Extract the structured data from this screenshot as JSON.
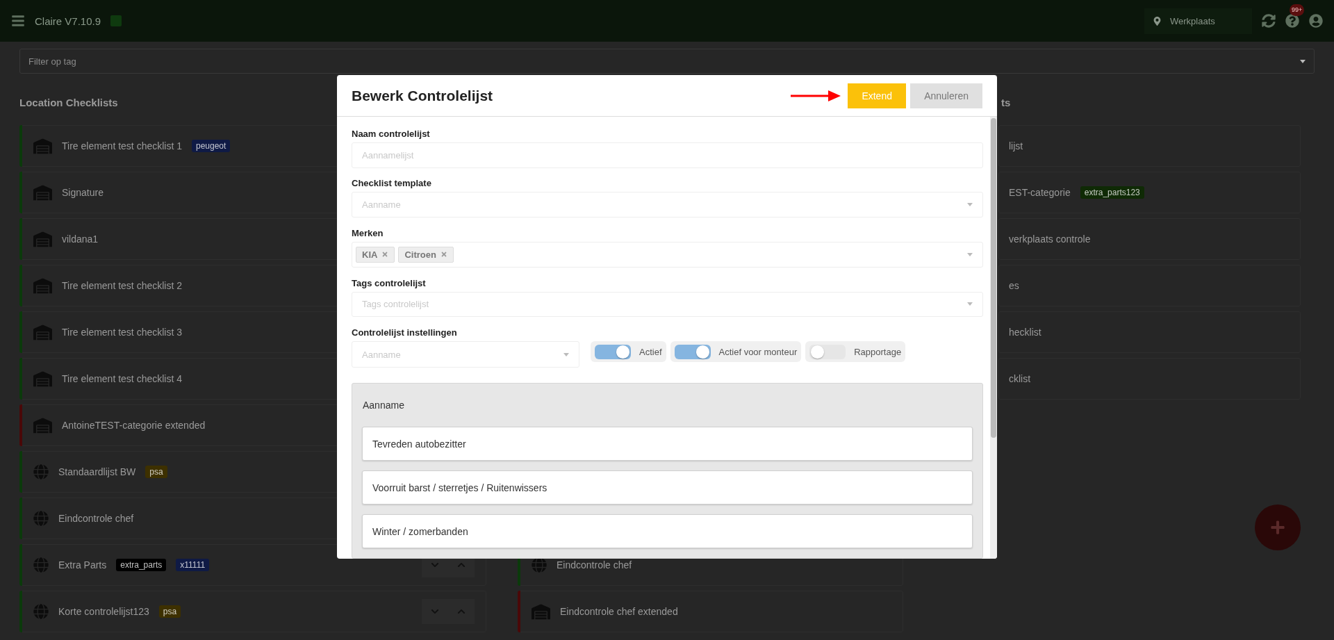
{
  "app": {
    "title": "Claire V7.10.9",
    "location": {
      "placeholder": "Werkplaats"
    },
    "notification_count": "99+"
  },
  "filter": {
    "placeholder": "Filter op tag"
  },
  "columns": [
    {
      "heading": "Location Checklists",
      "items": [
        {
          "name": "Tire element test checklist 1",
          "kind": "location",
          "color": "#0b3a0b",
          "tags": [
            {
              "label": "peugeot",
              "color": "#0f1a45"
            }
          ]
        },
        {
          "name": "Signature",
          "kind": "location",
          "color": "#0b3a0b"
        },
        {
          "name": "vildana1",
          "kind": "location",
          "color": "#0b3a0b"
        },
        {
          "name": "Tire element test checklist 2",
          "kind": "location",
          "color": "#0b3a0b"
        },
        {
          "name": "Tire element test checklist 3",
          "kind": "location",
          "color": "#0b3a0b"
        },
        {
          "name": "Tire element test checklist 4",
          "kind": "location",
          "color": "#0b3a0b"
        },
        {
          "name": "AntoineTEST-categorie extended",
          "kind": "location",
          "color": "#4a0808"
        },
        {
          "name": "Standaardlijst BW",
          "kind": "global",
          "color": "#0b3a0b",
          "tags": [
            {
              "label": "psa",
              "color": "#3d3000"
            }
          ]
        },
        {
          "name": "Eindcontrole chef",
          "kind": "global",
          "color": "#0b3a0b"
        },
        {
          "name": "Extra Parts",
          "kind": "global",
          "color": "#0b3a0b",
          "tags": [
            {
              "label": "extra_parts",
              "color": "#000000"
            },
            {
              "label": "x11111",
              "color": "#0f1a45"
            }
          ]
        },
        {
          "name": "Korte controlelijst123",
          "kind": "global",
          "color": "#0b3a0b",
          "tags": [
            {
              "label": "psa",
              "color": "#3d3000"
            }
          ]
        }
      ]
    },
    {
      "items": [
        {
          "name": "Eindcontrole chef",
          "kind": "global",
          "color": "#0b3a0b"
        },
        {
          "name": "Eindcontrole chef extended",
          "kind": "location",
          "color": "#4a0808"
        }
      ]
    },
    {
      "heading": "ts",
      "items": [
        {
          "name": "lijst"
        },
        {
          "name": "EST-categorie",
          "tags": [
            {
              "label": "extra_parts123",
              "color": "#0f2a05"
            }
          ]
        },
        {
          "name": "verkplaats controle"
        },
        {
          "name": "es"
        },
        {
          "name": "hecklist"
        },
        {
          "name": "cklist"
        }
      ]
    }
  ],
  "dialog": {
    "title": "Bewerk Controlelijst",
    "buttons": [
      {
        "label": "Extend",
        "kind": "primary"
      },
      {
        "label": "Annuleren",
        "kind": "secondary"
      }
    ],
    "fields": [
      {
        "label": "Naam controlelijst",
        "kind": "text",
        "placeholder": "Aannamelijst"
      },
      {
        "label": "Checklist template",
        "kind": "select",
        "placeholder": "Aanname"
      },
      {
        "label": "Merken",
        "kind": "multiselect",
        "chips": [
          "KIA",
          "Citroen"
        ]
      },
      {
        "label": "Tags controlelijst",
        "kind": "multiselect",
        "placeholder": "Tags controlelijst"
      }
    ],
    "settings": {
      "label": "Controlelijst instellingen",
      "select": {
        "placeholder": "Aanname"
      },
      "toggles": [
        {
          "label": "Actief",
          "on": true
        },
        {
          "label": "Actief voor monteur",
          "on": true
        },
        {
          "label": "Rapportage",
          "on": false
        }
      ]
    },
    "section": {
      "title": "Aanname",
      "items": [
        "Tevreden autobezitter",
        "Voorruit barst / sterretjes / Ruitenwissers",
        "Winter / zomerbanden"
      ]
    }
  }
}
